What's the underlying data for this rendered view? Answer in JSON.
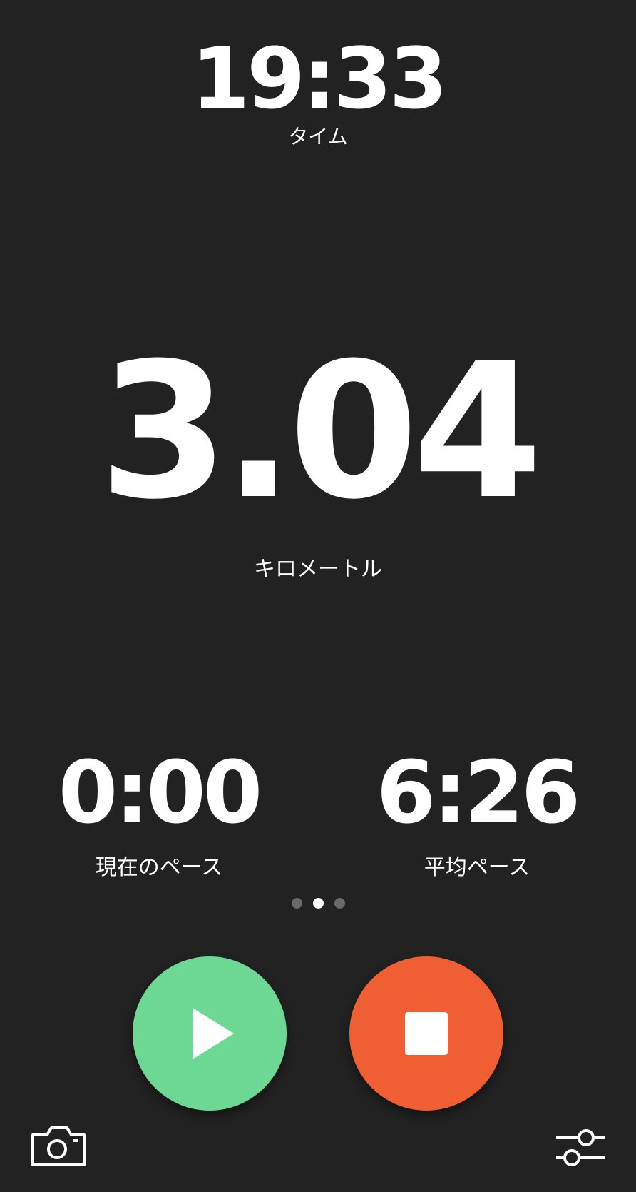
{
  "time": {
    "value": "19:33",
    "label": "タイム"
  },
  "distance": {
    "value": "3.04",
    "label": "キロメートル"
  },
  "current_pace": {
    "value": "0:00",
    "label": "現在のペース"
  },
  "average_pace": {
    "value": "6:26",
    "label": "平均ペース"
  },
  "pager": {
    "page_count": 3,
    "active_index": 1
  },
  "controls": {
    "play": {
      "icon": "play-icon",
      "color": "#6dd894"
    },
    "stop": {
      "icon": "stop-icon",
      "color": "#f05f33"
    }
  },
  "bottom_bar": {
    "left_icon": "camera-icon",
    "right_icon": "sliders-icon"
  },
  "colors": {
    "background": "#222222",
    "text": "#ffffff",
    "dot_inactive": "#6a6a6a"
  }
}
